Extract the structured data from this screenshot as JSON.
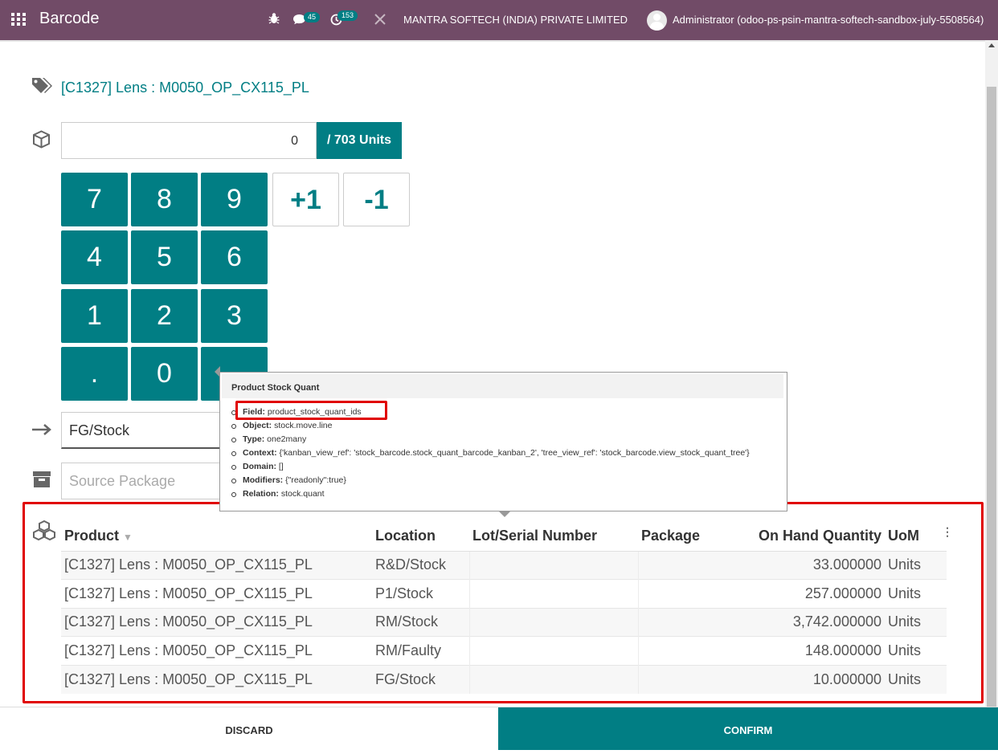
{
  "navbar": {
    "app_title": "Barcode",
    "bug_icon": "bug-icon",
    "messages_count": "45",
    "activities_count": "153",
    "company": "MANTRA SOFTECH (INDIA) PRIVATE LIMITED",
    "user": "Administrator (odoo-ps-psin-mantra-softech-sandbox-july-5508564)"
  },
  "product": {
    "name": "[C1327] Lens : M0050_OP_CX115_PL"
  },
  "quantity": {
    "value": "0",
    "demand": "/ 703 Units"
  },
  "keypad": {
    "k7": "7",
    "k8": "8",
    "k9": "9",
    "plus": "+1",
    "minus": "-1",
    "k4": "4",
    "k5": "5",
    "k6": "6",
    "k1": "1",
    "k2": "2",
    "k3": "3",
    "dot": ".",
    "k0": "0"
  },
  "fields": {
    "location_value": "FG/Stock",
    "package_placeholder": "Source Package"
  },
  "tooltip": {
    "title": "Product Stock Quant",
    "field_label": "Field:",
    "field_value": "product_stock_quant_ids",
    "object_label": "Object:",
    "object_value": "stock.move.line",
    "type_label": "Type:",
    "type_value": "one2many",
    "context_label": "Context:",
    "context_value": "{'kanban_view_ref': 'stock_barcode.stock_quant_barcode_kanban_2', 'tree_view_ref': 'stock_barcode.view_stock_quant_tree'}",
    "domain_label": "Domain:",
    "domain_value": "[]",
    "modifiers_label": "Modifiers:",
    "modifiers_value": "{\"readonly\":true}",
    "relation_label": "Relation:",
    "relation_value": "stock.quant"
  },
  "table": {
    "headers": {
      "product": "Product",
      "location": "Location",
      "lot": "Lot/Serial Number",
      "package": "Package",
      "onhand": "On Hand Quantity",
      "uom": "UoM"
    },
    "rows": [
      {
        "product": "[C1327] Lens : M0050_OP_CX115_PL",
        "location": "R&D/Stock",
        "lot": "",
        "package": "",
        "qty": "33.000000",
        "uom": "Units"
      },
      {
        "product": "[C1327] Lens : M0050_OP_CX115_PL",
        "location": "P1/Stock",
        "lot": "",
        "package": "",
        "qty": "257.000000",
        "uom": "Units"
      },
      {
        "product": "[C1327] Lens : M0050_OP_CX115_PL",
        "location": "RM/Stock",
        "lot": "",
        "package": "",
        "qty": "3,742.000000",
        "uom": "Units"
      },
      {
        "product": "[C1327] Lens : M0050_OP_CX115_PL",
        "location": "RM/Faulty",
        "lot": "",
        "package": "",
        "qty": "148.000000",
        "uom": "Units"
      },
      {
        "product": "[C1327] Lens : M0050_OP_CX115_PL",
        "location": "FG/Stock",
        "lot": "",
        "package": "",
        "qty": "10.000000",
        "uom": "Units"
      }
    ]
  },
  "footer": {
    "discard": "DISCARD",
    "confirm": "CONFIRM"
  },
  "colors": {
    "navbar": "#714b67",
    "primary": "#017e84",
    "highlight": "#e00000"
  }
}
